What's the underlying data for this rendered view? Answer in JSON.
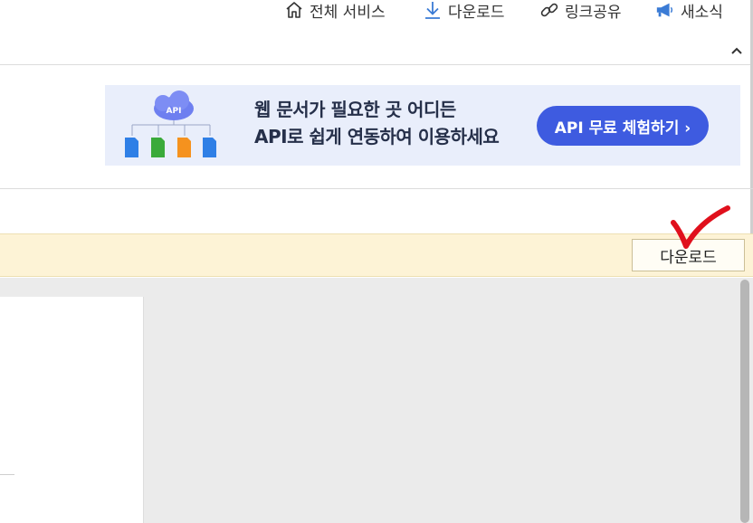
{
  "nav": {
    "items": [
      {
        "label": "전체 서비스",
        "icon": "home-icon"
      },
      {
        "label": "다운로드",
        "icon": "download-icon"
      },
      {
        "label": "링크공유",
        "icon": "link-icon"
      },
      {
        "label": "새소식",
        "icon": "megaphone-icon"
      }
    ]
  },
  "banner": {
    "badge": "API",
    "line1": "웹 문서가 필요한 곳 어디든",
    "line2": "API로 쉽게 연동하여 이용하세요",
    "cta": "API 무료 체험하기 ›",
    "colors": {
      "background": "#e9eefb",
      "cta": "#3e5be0"
    }
  },
  "toolbar": {
    "download_label": "다운로드",
    "background": "#fdf3d6"
  },
  "annotation": {
    "checkmark_color": "#e0101c"
  }
}
